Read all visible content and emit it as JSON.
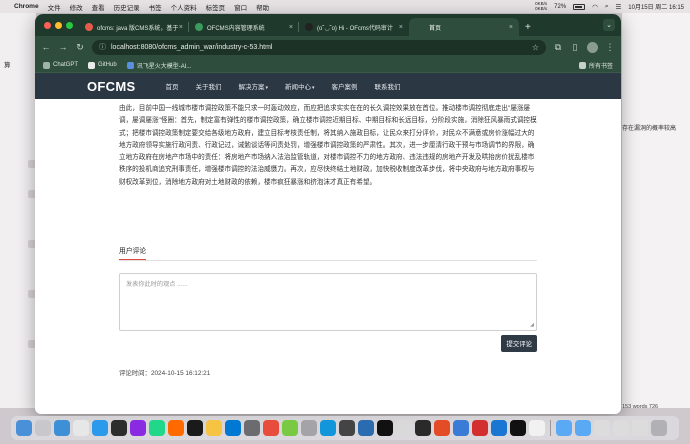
{
  "menubar": {
    "app": "Chrome",
    "items": [
      "文件",
      "修改",
      "查看",
      "历史记录",
      "书签",
      "个人资料",
      "标签页",
      "窗口",
      "帮助"
    ],
    "net_up": "0KB/s",
    "net_down": "0KB/s",
    "battery": "72%",
    "datetime": "10月15日 周二 16:15"
  },
  "background": {
    "right_text": "存在漏洞的概率较高",
    "left_text": "算",
    "status_words": "153 words",
    "status_num": "726"
  },
  "browser": {
    "tabs": [
      {
        "title": "ofcms: java 版CMS系统，基于",
        "color": "#e55b4b",
        "active": false
      },
      {
        "title": "OFCMS内容管理系统",
        "color": "#3a9b5c",
        "active": false
      },
      {
        "title": "(o˘◡˘o) Hi - OFcms代码审计",
        "color": "#222222",
        "active": false
      },
      {
        "title": "首页",
        "color": "#2e4d3c",
        "active": true
      }
    ],
    "url": "localhost:8080/ofcms_admin_war/industry-c-53.html",
    "bookmarks": [
      "ChatGPT",
      "GitHub",
      "讯飞星火大模型-AI..."
    ],
    "bookmarks_right": "所有书签"
  },
  "site": {
    "logo": "OFCMS",
    "nav": [
      "首页",
      "关于我们",
      "解决方案",
      "新闻中心",
      "客户案例",
      "联系我们"
    ],
    "paragraph": "由此，目前中国一线城市楼市调控政策不能只求一时轰动效应，而应把追求实实在在的长久调控效果放在首位。推动楼市调控彻底走出\"屡涨屡调，屡调屡涨\"怪圈：首先，制定富有弹性的楼市调控政策，确立楼市调控近期目标、中期目标和长远目标，分阶段实施，消除狂风暴雨式调控模式；把楼市调控政策制定要交给各级地方政府，建立目标考核责任制，将其纳入施政目标，让民众来打分评价，对民众不满意或房价涨幅过大的地方政府领导实施行政问责、行政记过，诫勉谈话等问责处罚，增强楼市调控政策的严肃性。其次，进一步厘清行政干预与市场调节的界限，确立地方政府在房地产市场中的责任：将房地产市场纳入法治监管轨道，对楼市调控不力的地方政府、违法违规的房地产开发及哄抬房价扰乱楼市秩序的投机商追究刑事责任，增强楼市调控的法治威慑力。再次，应尽快终结土地财政，加快税收制度改革步伐，将中央政府与地方政府事权与财权改革到位，消除地方政府对土地财政的依赖，楼市疯狂暴涨和挤泡沫才真正有希望。",
    "comments_title": "用户评论",
    "comment_placeholder": "发表你此时的观点 ......",
    "submit_label": "提交评论",
    "comment_time": "评论时间：2024-10-15 16:12:21"
  },
  "colors": {
    "tab_bar": "#1f3a2c",
    "toolbar": "#2e4d3c",
    "site_nav": "#2c3744",
    "accent": "#e04a3c"
  }
}
